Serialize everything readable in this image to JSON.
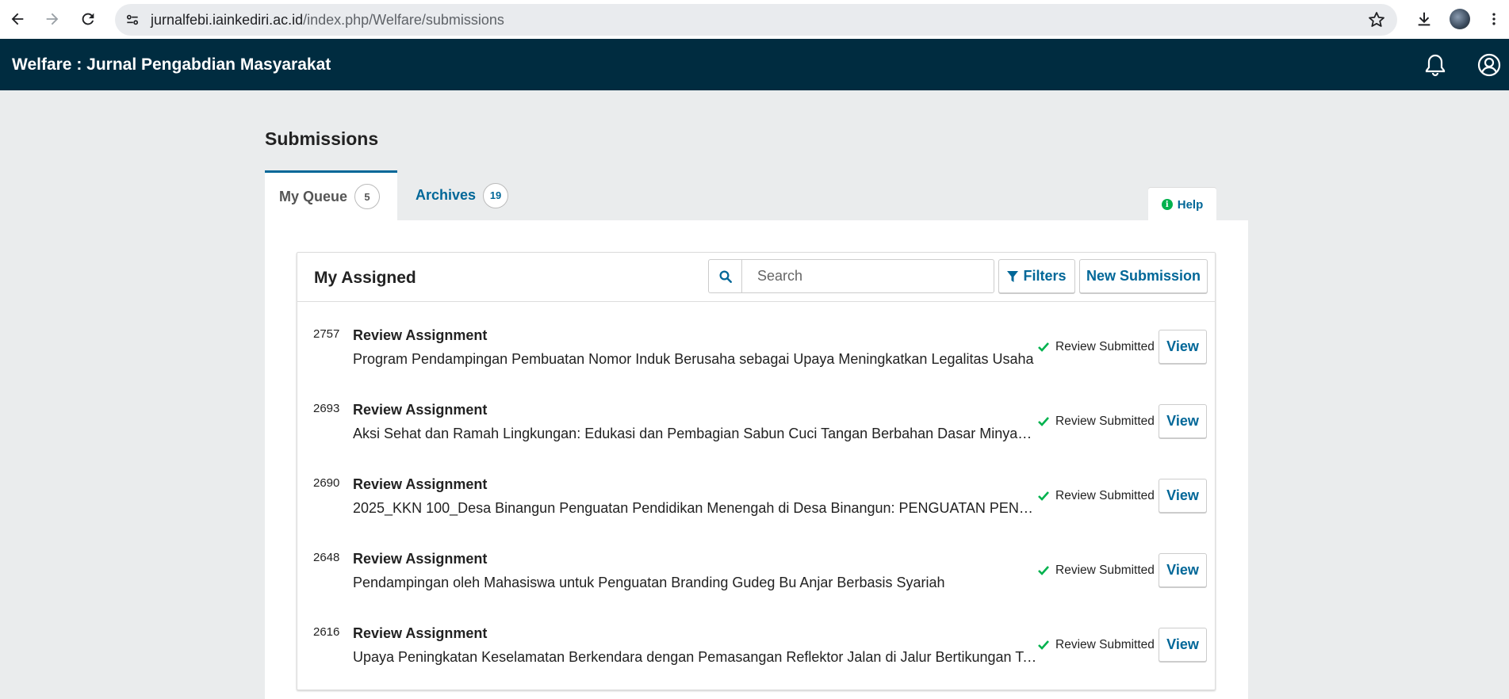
{
  "browser": {
    "url_host": "jurnalfebi.iainkediri.ac.id",
    "url_path": "/index.php/Welfare/submissions",
    "icons": [
      "back-icon",
      "forward-icon",
      "reload-icon",
      "site-info-icon",
      "star-icon",
      "download-icon",
      "profile-avatar",
      "more-icon"
    ]
  },
  "header": {
    "title": "Welfare : Jurnal Pengabdian Masyarakat",
    "icons": [
      "bell-icon",
      "user-icon"
    ]
  },
  "page": {
    "title": "Submissions"
  },
  "tabs": [
    {
      "label": "My Queue",
      "count": "5",
      "active": true
    },
    {
      "label": "Archives",
      "count": "19",
      "active": false
    }
  ],
  "help": {
    "label": "Help"
  },
  "list": {
    "title": "My Assigned",
    "search_placeholder": "Search",
    "filters_label": "Filters",
    "new_submission_label": "New Submission",
    "items": [
      {
        "id": "2757",
        "type": "Review Assignment",
        "title": "Program Pendampingan Pembuatan Nomor Induk Berusaha sebagai Upaya Meningkatkan Legalitas Usaha",
        "status": "Review Submitted",
        "action": "View"
      },
      {
        "id": "2693",
        "type": "Review Assignment",
        "title": "Aksi Sehat dan Ramah Lingkungan: Edukasi dan Pembagian Sabun Cuci Tangan Berbahan Dasar Minyak Jelantah",
        "status": "Review Submitted",
        "action": "View"
      },
      {
        "id": "2690",
        "type": "Review Assignment",
        "title": "2025_KKN 100_Desa Binangun Penguatan Pendidikan Menengah di Desa Binangun: PENGUATAN PENDIDIKAN",
        "status": "Review Submitted",
        "action": "View"
      },
      {
        "id": "2648",
        "type": "Review Assignment",
        "title": "Pendampingan oleh Mahasiswa untuk Penguatan Branding Gudeg Bu Anjar Berbasis Syariah",
        "status": "Review Submitted",
        "action": "View"
      },
      {
        "id": "2616",
        "type": "Review Assignment",
        "title": "Upaya Peningkatan Keselamatan Berkendara dengan Pemasangan Reflektor Jalan di Jalur Bertikungan Tajam",
        "status": "Review Submitted",
        "action": "View"
      }
    ]
  },
  "colors": {
    "header_bg": "#002c40",
    "link": "#006798",
    "success": "#00b24e",
    "page_bg": "#eaeced"
  }
}
